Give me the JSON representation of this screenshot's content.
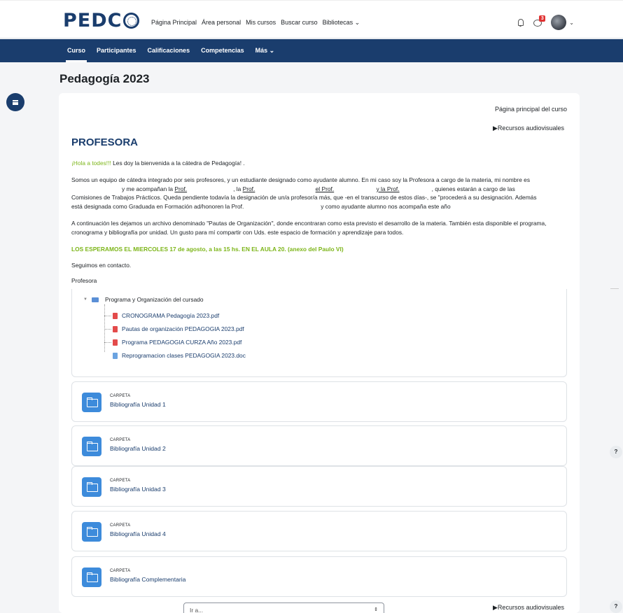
{
  "brand": {
    "logo_text": "PEDC",
    "logo_icon": "globe-icon"
  },
  "topnav": {
    "items": [
      "Página Principal",
      "Área personal",
      "Mis cursos",
      "Buscar curso",
      "Bibliotecas ⌄"
    ],
    "notification_count": "3"
  },
  "secnav": {
    "items": [
      "Curso",
      "Participantes",
      "Calificaciones",
      "Competencias",
      "Más ⌄"
    ]
  },
  "page": {
    "title": "Pedagogía 2023"
  },
  "course": {
    "main_link": "Página principal del curso",
    "audiovisual_link": "▶Recursos audiovisuales",
    "heading": "PROFESORA",
    "greeting_bold": "¡Hola a todes!!!",
    "greeting_rest": " Les doy la bienvenida a la cátedra de Pedagogía! .",
    "p1_a": "Somos un equipo de cátedra integrado por seis profesores,  y un estudiante designado como ayudante alumno. En mi caso soy la Profesora a cargo de la materia, mi nombre es",
    "p1_b": "y me acompañan la",
    "p1_prof1": "Prof.",
    "p1_la": ", la",
    "p1_prof2": "Prof.",
    "p1_el": "el Prof.",
    "p1_yla": "y la  Prof.",
    "p1_c": ", quienes estarán a cargo de las",
    "p1_d": "Comisiones de Trabajos Prácticos. Queda pendiente todavía la designación de un/a profesor/a más, que -en el transcurso de estos días-, se \"procederá a su designación. Además",
    "p1_e": "está designada como Graduada en Formación ad/honoren la Prof.",
    "p1_f": "y como ayudante alumno nos acompaña este año",
    "p2": "A continuación les dejamos un archivo denominado \"Pautas de Organización\", donde encontraran como esta previsto el desarrollo de la materia. También esta disponible el programa, cronograma y bibliografía por unidad. Un gusto para mí compartir con Uds. este espacio de formación y aprendizaje para todos.",
    "announce": "LOS ESPERAMOS EL MIERCOLES 17 de agosto, a las  15 hs. EN EL AULA 20. (anexo del Paulo VI)",
    "contact": "Seguimos en contacto.",
    "sign": "Profesora"
  },
  "tree": {
    "root": "Programa y Organización del cursado",
    "files": [
      {
        "name": "CRONOGRAMA Pedagogía 2023.pdf",
        "icon": "pdf-icon"
      },
      {
        "name": "Pautas de organización PEDAGOGIA 2023.pdf",
        "icon": "pdf-icon"
      },
      {
        "name": "Programa PEDAGOGIA CURZA Año 2023.pdf",
        "icon": "pdf-icon"
      },
      {
        "name": "Reprogramacion clases PEDAGOGIA 2023.doc",
        "icon": "doc-icon"
      }
    ]
  },
  "folders": [
    {
      "type": "CARPETA",
      "name": "Bibliografía Unidad 1"
    },
    {
      "type": "CARPETA",
      "name": "Bibliografía Unidad 2"
    },
    {
      "type": "CARPETA",
      "name": "Bibliografía Unidad 3"
    },
    {
      "type": "CARPETA",
      "name": "Bibliografía Unidad 4"
    },
    {
      "type": "CARPETA",
      "name": "Bibliografía Complementaria"
    }
  ],
  "footer": {
    "goto_placeholder": "Ir a...",
    "audiovisual_link": "▶Recursos audiovisuales"
  },
  "help": {
    "label": "?"
  },
  "colors": {
    "brand_navy": "#1a3d6d",
    "green_text": "#7cb518",
    "folder_blue": "#3d8bdb",
    "badge_red": "#e03232"
  }
}
